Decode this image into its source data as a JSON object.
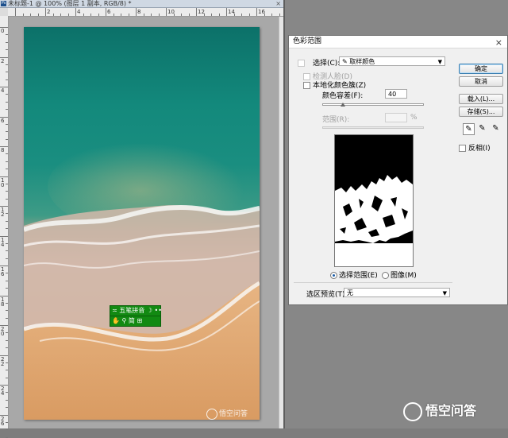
{
  "document": {
    "title": "未标题-1 @ 100% (图层 1 副本, RGB/8) *",
    "close_glyph": "×",
    "ruler_top_labels": [
      "",
      "2",
      "4",
      "6",
      "8",
      "10",
      "12",
      "14",
      "16"
    ],
    "ruler_left_labels": [
      "0",
      "2",
      "4",
      "6",
      "8",
      "10",
      "12",
      "14",
      "16",
      "18",
      "20",
      "22",
      "24",
      "26"
    ]
  },
  "navigator": {
    "row1_text": "五笔拼音",
    "row1_icons": "☽ ••",
    "row2_text": "简 ⊞"
  },
  "watermark": {
    "small": "悟空问答",
    "large": "悟空问答"
  },
  "dialog": {
    "title": "色彩范围",
    "close_glyph": "×",
    "select_label": "选择(C):",
    "select_value": "取样颜色",
    "detect_faces": "检测人脸(D)",
    "localized_clusters": "本地化颜色簇(Z)",
    "fuzziness_label": "颜色容差(F):",
    "fuzziness_value": "40",
    "fuzziness_level": 0.2,
    "range_label": "范围(R):",
    "range_unit": "%",
    "radio_selection": "选择范围(E)",
    "radio_image": "图像(M)",
    "preview_label": "选区预览(T):",
    "preview_value": "无",
    "buttons": {
      "ok": "确定",
      "cancel": "取消",
      "load": "载入(L)...",
      "save": "存储(S)..."
    },
    "invert": "反相(I)",
    "eyedroppers": [
      "eyedropper",
      "eyedropper-plus",
      "eyedropper-minus"
    ]
  },
  "colors": {
    "nav_green": "#128a12",
    "ok_border": "#3c7fb1"
  }
}
